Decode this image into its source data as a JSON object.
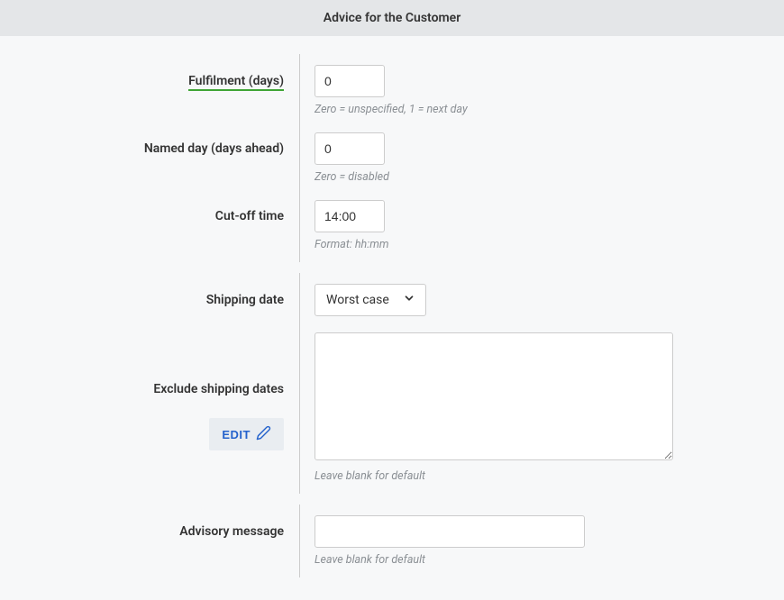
{
  "header": {
    "title": "Advice for the Customer"
  },
  "fields": {
    "fulfilment": {
      "label": "Fulfilment (days)",
      "value": "0",
      "help": "Zero = unspecified, 1 = next day"
    },
    "named_day": {
      "label": "Named day (days ahead)",
      "value": "0",
      "help": "Zero = disabled"
    },
    "cut_off": {
      "label": "Cut-off time",
      "value": "14:00",
      "help": "Format: hh:mm"
    },
    "shipping_date": {
      "label": "Shipping date",
      "selected": "Worst case"
    },
    "exclude_shipping": {
      "label": "Exclude shipping dates",
      "edit_label": "EDIT",
      "value": "",
      "help": "Leave blank for default"
    },
    "advisory": {
      "label": "Advisory message",
      "value": "",
      "help": "Leave blank for default"
    }
  }
}
